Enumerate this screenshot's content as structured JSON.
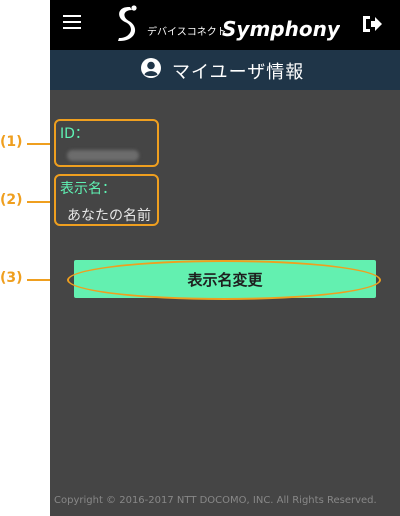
{
  "header": {
    "logo_text": "デバイスコネクト",
    "logo_brand": "Symphony",
    "menu_icon": "hamburger-menu-icon",
    "logout_icon": "logout-icon"
  },
  "subheader": {
    "title": "マイユーザ情報",
    "icon": "user-circle-icon"
  },
  "fields": {
    "id_label": "ID：",
    "display_name_label": "表示名：",
    "display_name_value": "あなたの名前"
  },
  "actions": {
    "change_display_name": "表示名変更"
  },
  "annotations": {
    "a1": "(1)",
    "a2": "(2)",
    "a3": "(3)"
  },
  "footer": {
    "copyright": "Copyright © 2016-2017 NTT DOCOMO, INC. All Rights Reserved."
  },
  "colors": {
    "accent_green": "#5ff3b4",
    "annotation_orange": "#ef9f1f",
    "header_black": "#000000",
    "subheader_navy": "#1f3548",
    "body_gray": "#454545"
  }
}
